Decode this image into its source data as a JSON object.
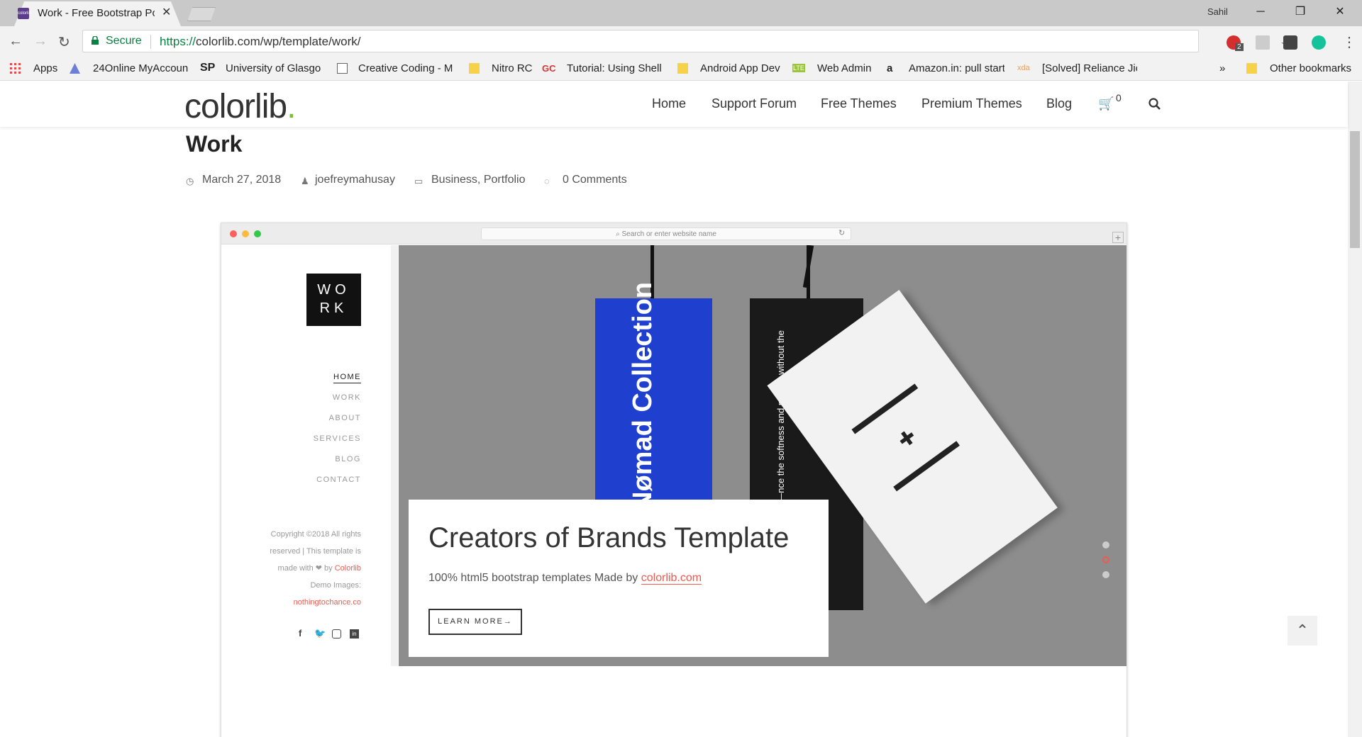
{
  "browser": {
    "tab_title": "Work - Free Bootstrap Po",
    "favicon_text": "colorlib",
    "user": "Sahil",
    "secure_label": "Secure",
    "url_scheme": "https://",
    "url_host": "colorlib.com",
    "url_path": "/wp/template/work/",
    "ext_badge": "2",
    "win_minimize": "─",
    "win_restore": "❐",
    "win_close": "✕"
  },
  "bookmarks": {
    "apps": "Apps",
    "items": [
      "24Online MyAccoun",
      "University of Glasgo",
      "Creative Coding - M",
      "Nitro RC",
      "Tutorial: Using Shell",
      "Android App Dev",
      "Web Admin",
      "Amazon.in: pull start",
      "[Solved] Reliance Jio"
    ],
    "icons": [
      "SP",
      "GC",
      "LTE",
      "a",
      "xda"
    ],
    "more": "»",
    "other": "Other bookmarks"
  },
  "site": {
    "logo": "colorlib",
    "logo_dot": ".",
    "nav": [
      "Home",
      "Support Forum",
      "Free Themes",
      "Premium Themes",
      "Blog"
    ],
    "cart_count": "0"
  },
  "post": {
    "title": "Work",
    "date": "March 27, 2018",
    "author": "joefreymahusay",
    "categories": "Business, Portfolio",
    "comments": "0 Comments"
  },
  "mock": {
    "url_placeholder": "Search or enter website name",
    "logo_line1": "WO",
    "logo_line2": "RK",
    "nav": [
      "HOME",
      "WORK",
      "ABOUT",
      "SERVICES",
      "BLOG",
      "CONTACT"
    ],
    "copyright": "Copyright ©2018 All rights reserved | This template is made with ❤ by",
    "copyright_link": "Colorlib",
    "demo": "Demo Images:",
    "demo_link": "nothingtochance.co",
    "hero_title": "Creators of Brands Template",
    "hero_sub": "100% html5 bootstrap templates Made by",
    "hero_link": "colorlib.com",
    "learn_more": "LEARN MORE",
    "tag_blue_text": "Nømad Collection",
    "tag_black_text": "e-Washable Merino—nce the softness and merino without the dry cleane",
    "social": [
      "f",
      "t",
      "ig",
      "in"
    ]
  },
  "colors": {
    "accent": "#ee5a4e",
    "logo_dot": "#7dbd3f",
    "secure": "#0b8043",
    "tag_blue": "#1f3fcf"
  }
}
